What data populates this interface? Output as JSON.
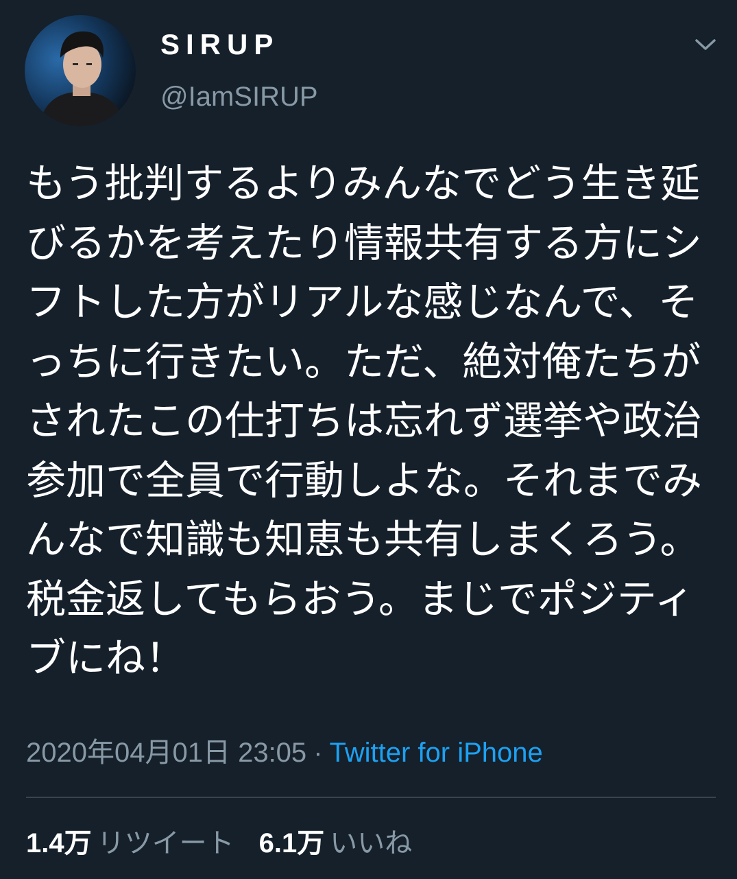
{
  "user": {
    "display_name": "SIRUP",
    "handle": "@IamSIRUP"
  },
  "tweet": {
    "text": "もう批判するよりみんなでどう生き延びるかを考えたり情報共有する方にシフトした方がリアルな感じなんで、そっちに行きたい。ただ、絶対俺たちがされたこの仕打ちは忘れず選挙や政治参加で全員で行動しよな。それまでみんなで知識も知恵も共有しまくろう。税金返してもらおう。まじでポジティブにね！",
    "timestamp": "2020年04月01日 23:05",
    "separator": "·",
    "source": "Twitter for iPhone"
  },
  "stats": {
    "retweets_count": "1.4万",
    "retweets_label": "リツイート",
    "likes_count": "6.1万",
    "likes_label": "いいね"
  },
  "icons": {
    "menu": "chevron-down-icon"
  },
  "colors": {
    "background": "#15202b",
    "primary_text": "#ffffff",
    "secondary_text": "#8899a6",
    "link": "#1da1f2",
    "divider": "#38444d"
  }
}
